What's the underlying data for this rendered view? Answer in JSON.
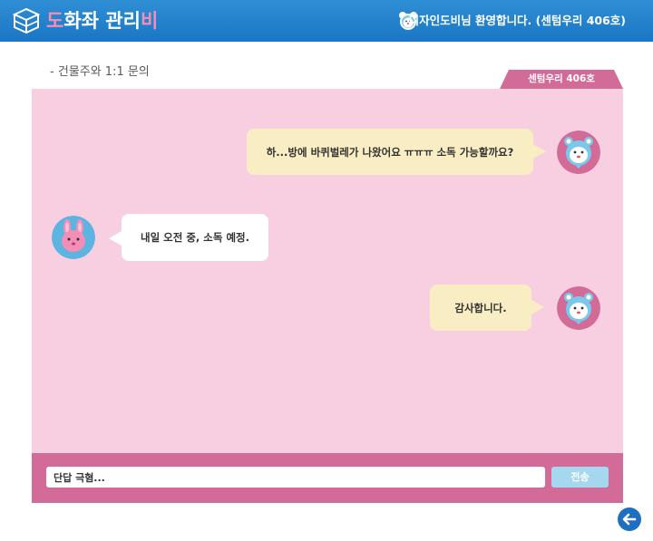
{
  "header": {
    "logo_icon": "box-icon",
    "logo_title_chars": [
      {
        "ch": "도",
        "color": "#f38fb7"
      },
      {
        "ch": "화",
        "color": "#ffffff"
      },
      {
        "ch": "좌",
        "color": "#ffffff"
      },
      {
        "ch": " ",
        "color": "#ffffff"
      },
      {
        "ch": "관",
        "color": "#ffffff"
      },
      {
        "ch": "리",
        "color": "#ffffff"
      },
      {
        "ch": "비",
        "color": "#f38fb7"
      }
    ],
    "welcome_text": "디자인도비님 환영합니다. (센텀우리 406호)",
    "avatar_icon": "bear-avatar-icon"
  },
  "page": {
    "title": "- 건물주와 1:1 문의",
    "room_tab": "센텀우리 406호"
  },
  "messages": [
    {
      "from": "me",
      "text": "하...방에 바퀴벌레가 나왔어요 ㅠㅠㅠ 소독 가능할까요?",
      "avatar": "bear-avatar-icon"
    },
    {
      "from": "owner",
      "text": "내일 오전 중, 소독 예정.",
      "avatar": "rabbit-avatar-icon"
    },
    {
      "from": "me",
      "text": "감사합니다.",
      "avatar": "bear-avatar-icon"
    }
  ],
  "composer": {
    "input_value": "단답 극혐...",
    "send_label": "전송"
  },
  "footer": {
    "back_icon": "arrow-left-icon"
  },
  "colors": {
    "header_blue": "#1a76c3",
    "accent_pink": "#d36b99",
    "chat_bg": "#f7cfe1",
    "my_bubble": "#f9edc3",
    "send_button": "#a5d8ee"
  }
}
